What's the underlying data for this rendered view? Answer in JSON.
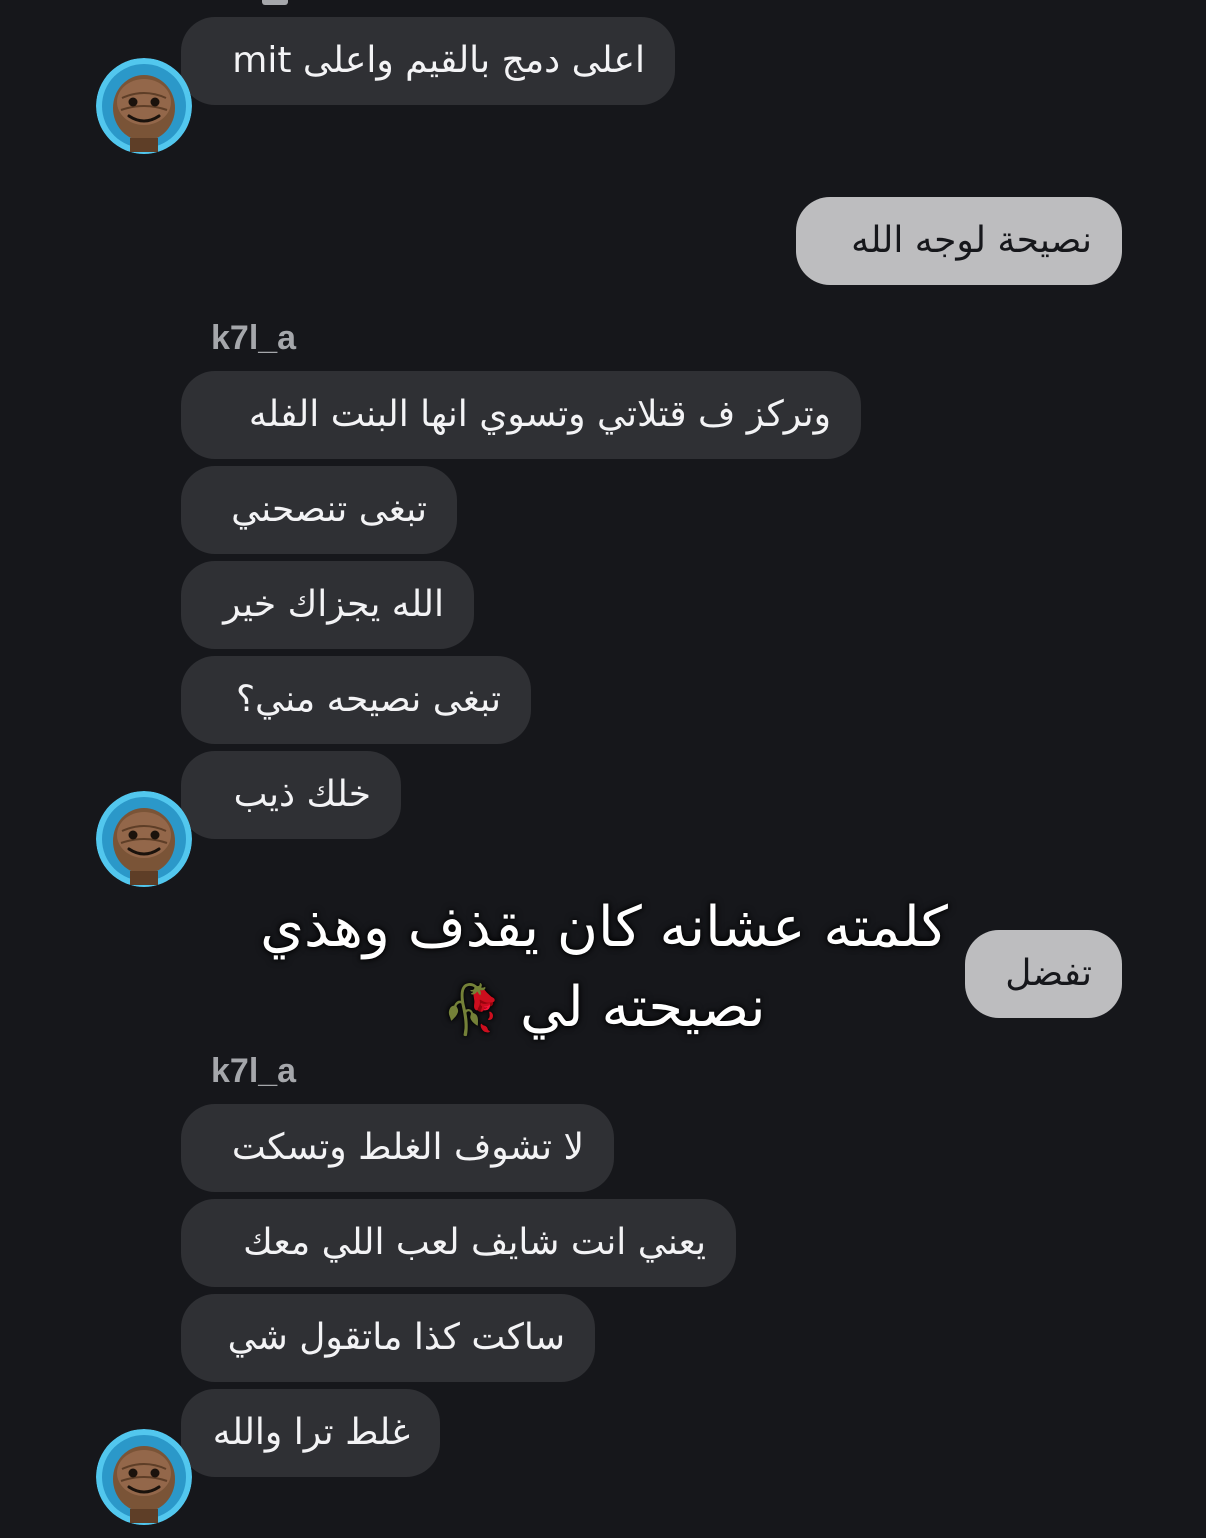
{
  "colors": {
    "background": "#16171b",
    "incoming_bubble": "#2f3034",
    "outgoing_bubble": "#bdbdbf",
    "sender_name": "#a5a7ab",
    "avatar_ring": "#52c7ee"
  },
  "messages": [
    {
      "id": "m1",
      "direction": "incoming",
      "text": "اعلى دمج بالقيم واعلى mit"
    },
    {
      "id": "m2",
      "direction": "outgoing",
      "text": "نصيحة لوجه الله"
    },
    {
      "id": "m3",
      "direction": "incoming",
      "sender": "k7l_a",
      "text": "وتركز ف قتلاتي وتسوي انها البنت الفله"
    },
    {
      "id": "m4",
      "direction": "incoming",
      "text": "تبغى تنصحني"
    },
    {
      "id": "m5",
      "direction": "incoming",
      "text": "الله يجزاك خير"
    },
    {
      "id": "m6",
      "direction": "incoming",
      "text": "تبغى نصيحه مني؟"
    },
    {
      "id": "m7",
      "direction": "incoming",
      "text": "خلك ذيب"
    },
    {
      "id": "m8",
      "direction": "outgoing",
      "text": "تفضل"
    },
    {
      "id": "m9",
      "direction": "incoming",
      "sender": "k7l_a",
      "text": "لا تشوف الغلط وتسكت"
    },
    {
      "id": "m10",
      "direction": "incoming",
      "text": "يعني انت شايف لعب اللي معك"
    },
    {
      "id": "m11",
      "direction": "incoming",
      "text": "ساكت كذا ماتقول شي"
    },
    {
      "id": "m12",
      "direction": "incoming",
      "text": "غلط ترا والله"
    }
  ],
  "overlay": {
    "line1": "كلمته عشانه كان يقذف وهذي",
    "line2": "نصيحته لي",
    "emoji": "🥀"
  },
  "avatar": {
    "icon": "sackboy-avatar-icon"
  }
}
